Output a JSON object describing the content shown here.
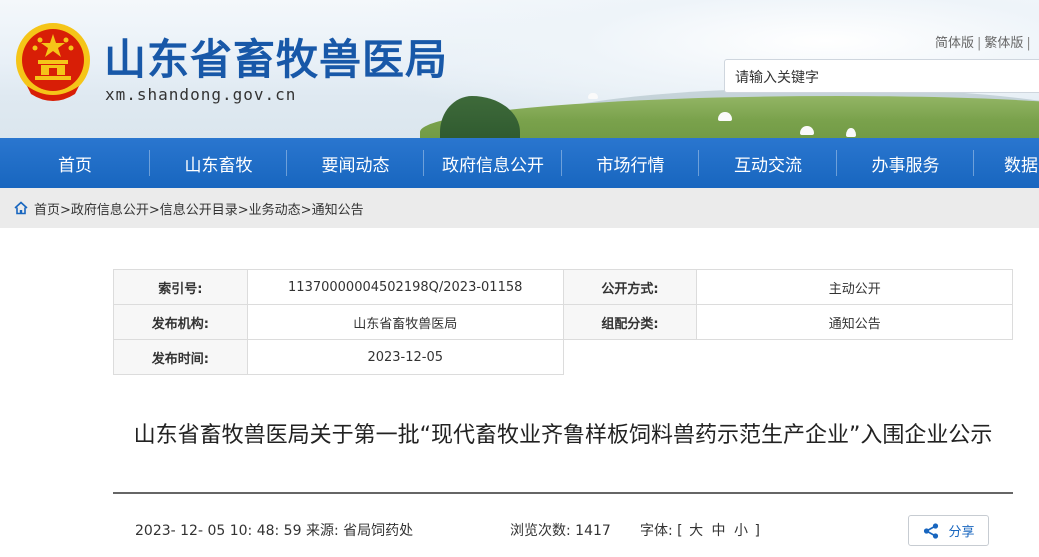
{
  "header": {
    "site_title": "山东省畜牧兽医局",
    "site_domain": "xm.shandong.gov.cn",
    "lang_simplified": "简体版",
    "lang_traditional": "繁体版",
    "lang_sep": "|",
    "search_placeholder": "请输入关键字"
  },
  "nav": {
    "items": [
      "首页",
      "山东畜牧",
      "要闻动态",
      "政府信息公开",
      "市场行情",
      "互动交流",
      "办事服务",
      "数据"
    ]
  },
  "breadcrumb": {
    "text": "首页>政府信息公开>信息公开目录>业务动态>通知公告"
  },
  "info": {
    "index_label": "索引号:",
    "index_value": "11370000004502198Q/2023-01158",
    "open_label": "公开方式:",
    "open_value": "主动公开",
    "org_label": "发布机构:",
    "org_value": "山东省畜牧兽医局",
    "category_label": "组配分类:",
    "category_value": "通知公告",
    "date_label": "发布时间:",
    "date_value": "2023-12-05"
  },
  "article": {
    "title": "山东省畜牧兽医局关于第一批“现代畜牧业齐鲁样板饲料兽药示范生产企业”入围企业公示",
    "datetime_source": "2023- 12- 05 10: 48: 59 来源:   省局饲药处",
    "views": "浏览次数: 1417",
    "font_label": "字体:",
    "font_open": "[",
    "font_large": "大",
    "font_medium": "中",
    "font_small": "小",
    "font_close": "]",
    "share_label": "分享"
  },
  "colors": {
    "brand_blue": "#1866bf",
    "title_blue": "#1858a8",
    "emblem_red": "#d81e06",
    "emblem_gold": "#f5c518"
  }
}
